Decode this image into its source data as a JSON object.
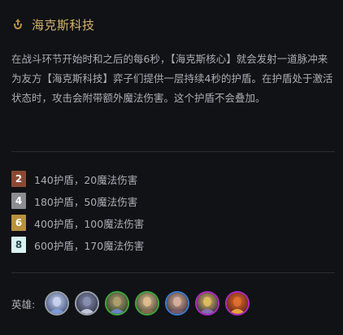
{
  "trait": {
    "icon": "hextech-trait-icon",
    "title": "海克斯科技",
    "description": "在战斗环节开始时和之后的每6秒，【海克斯核心】就会发射一道脉冲来为友方【海克斯科技】弈子们提供一层持续4秒的护盾。在护盾处于激活状态时，攻击会附带额外魔法伤害。这个护盾不会叠加。"
  },
  "tiers": [
    {
      "count": "2",
      "text": "140护盾，20魔法伤害",
      "color": "#8a4a32",
      "text_color": "#ffffff"
    },
    {
      "count": "4",
      "text": "180护盾，50魔法伤害",
      "color": "#8a8d92",
      "text_color": "#ffffff"
    },
    {
      "count": "6",
      "text": "400护盾，100魔法伤害",
      "color": "#b8913e",
      "text_color": "#ffffff"
    },
    {
      "count": "8",
      "text": "600护盾，170魔法伤害",
      "color": "#d9f3f2",
      "text_color": "#2a4a4a"
    }
  ],
  "champions": {
    "label": "英雄:",
    "items": [
      {
        "icon": "champion-portrait-icon",
        "border": "#9aa0a8",
        "palette": [
          "#3a4a7a",
          "#c9d4f0",
          "#7fa0e0"
        ]
      },
      {
        "icon": "champion-portrait-icon",
        "border": "#9aa0a8",
        "palette": [
          "#2c2f44",
          "#8a8fb0",
          "#d0d4e8"
        ]
      },
      {
        "icon": "champion-portrait-icon",
        "border": "#3fa83a",
        "palette": [
          "#2d3a2a",
          "#b0a070",
          "#6a8ad0"
        ]
      },
      {
        "icon": "champion-portrait-icon",
        "border": "#3fa83a",
        "palette": [
          "#3a3a30",
          "#e0c090",
          "#8a6a50"
        ]
      },
      {
        "icon": "champion-portrait-icon",
        "border": "#3a7ad0",
        "palette": [
          "#3a2c2a",
          "#d8b0a0",
          "#7a5a6a"
        ]
      },
      {
        "icon": "champion-portrait-icon",
        "border": "#b02ac0",
        "palette": [
          "#2a2040",
          "#e0c060",
          "#8a70c0"
        ]
      },
      {
        "icon": "champion-portrait-icon",
        "border": "#b02ac0",
        "palette": [
          "#5a1a10",
          "#e07030",
          "#f0b040"
        ]
      }
    ]
  }
}
